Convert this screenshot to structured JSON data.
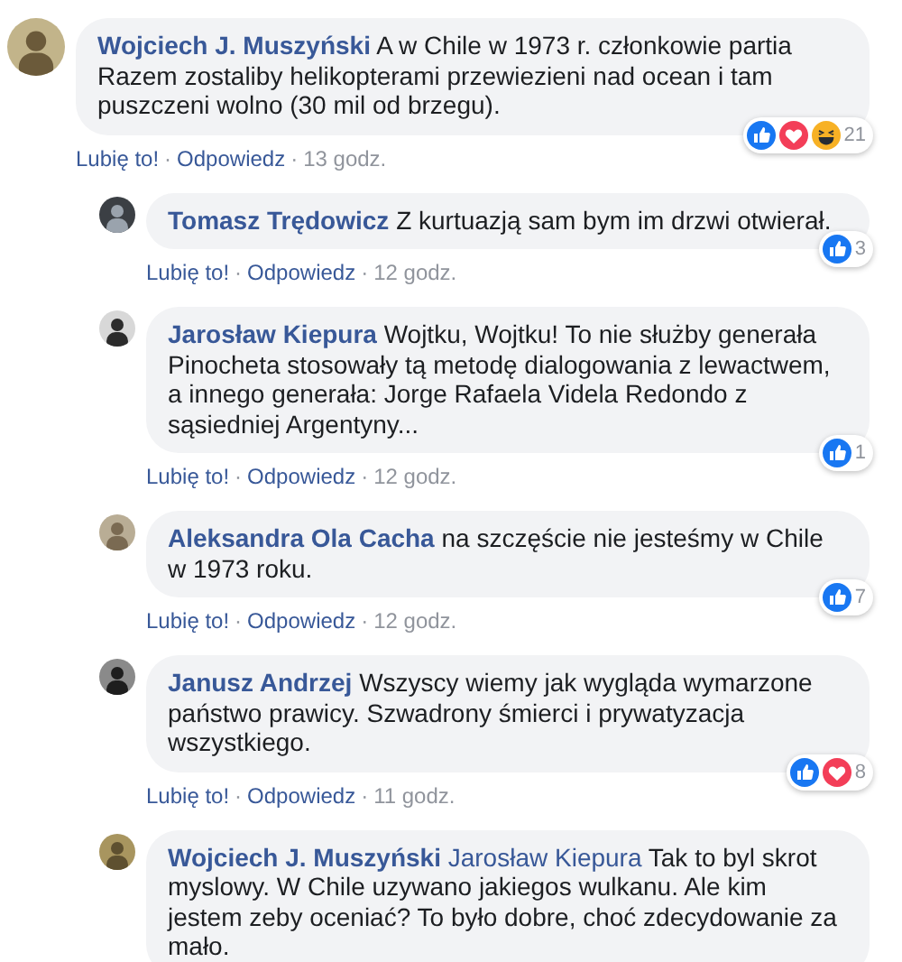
{
  "comments": [
    {
      "author": "Wojciech J. Muszyński",
      "text": "A w Chile w 1973 r. członkowie partia Razem zostaliby helikopterami przewiezieni nad ocean i tam puszczeni wolno (30 mil od brzegu).",
      "reply": false,
      "reactions": [
        {
          "kind": "like"
        },
        {
          "kind": "love"
        },
        {
          "kind": "haha"
        }
      ],
      "reaction_count": "21",
      "like": "Lubię to!",
      "separator": "·",
      "answer": "Odpowiedz",
      "time": "13 godz."
    },
    {
      "author": "Tomasz Trędowicz",
      "text": "Z kurtuazją sam bym im drzwi otwierał.",
      "reply": true,
      "reactions": [
        {
          "kind": "like"
        }
      ],
      "reaction_count": "3",
      "like": "Lubię to!",
      "separator": "·",
      "answer": "Odpowiedz",
      "time": "12 godz."
    },
    {
      "author": "Jarosław Kiepura",
      "text": "Wojtku, Wojtku! To nie służby generała Pinocheta stosowały tą metodę dialogowania z lewactwem, a innego generała: Jorge Rafaela Videla Redondo z sąsiedniej Argentyny...",
      "reply": true,
      "reactions": [
        {
          "kind": "like"
        }
      ],
      "reaction_count": "1",
      "like": "Lubię to!",
      "separator": "·",
      "answer": "Odpowiedz",
      "time": "12 godz."
    },
    {
      "author": "Aleksandra Ola Cacha",
      "text": "na szczęście nie jesteśmy w Chile w 1973 roku.",
      "reply": true,
      "reactions": [
        {
          "kind": "like"
        }
      ],
      "reaction_count": "7",
      "like": "Lubię to!",
      "separator": "·",
      "answer": "Odpowiedz",
      "time": "12 godz."
    },
    {
      "author": "Janusz Andrzej",
      "text": "Wszyscy wiemy jak wygląda wymarzone państwo prawicy. Szwadrony śmierci i prywatyzacja wszystkiego.",
      "reply": true,
      "reactions": [
        {
          "kind": "like"
        },
        {
          "kind": "love"
        }
      ],
      "reaction_count": "8",
      "like": "Lubię to!",
      "separator": "·",
      "answer": "Odpowiedz",
      "time": "11 godz."
    },
    {
      "author": "Wojciech J. Muszyński",
      "mention": "Jarosław Kiepura",
      "text": "Tak to byl skrot myslowy. W Chile uzywano jakiegos wulkanu. Ale kim jestem zeby oceniać? To było dobre, choć zdecydowanie za mało.",
      "reply": true
    }
  ]
}
